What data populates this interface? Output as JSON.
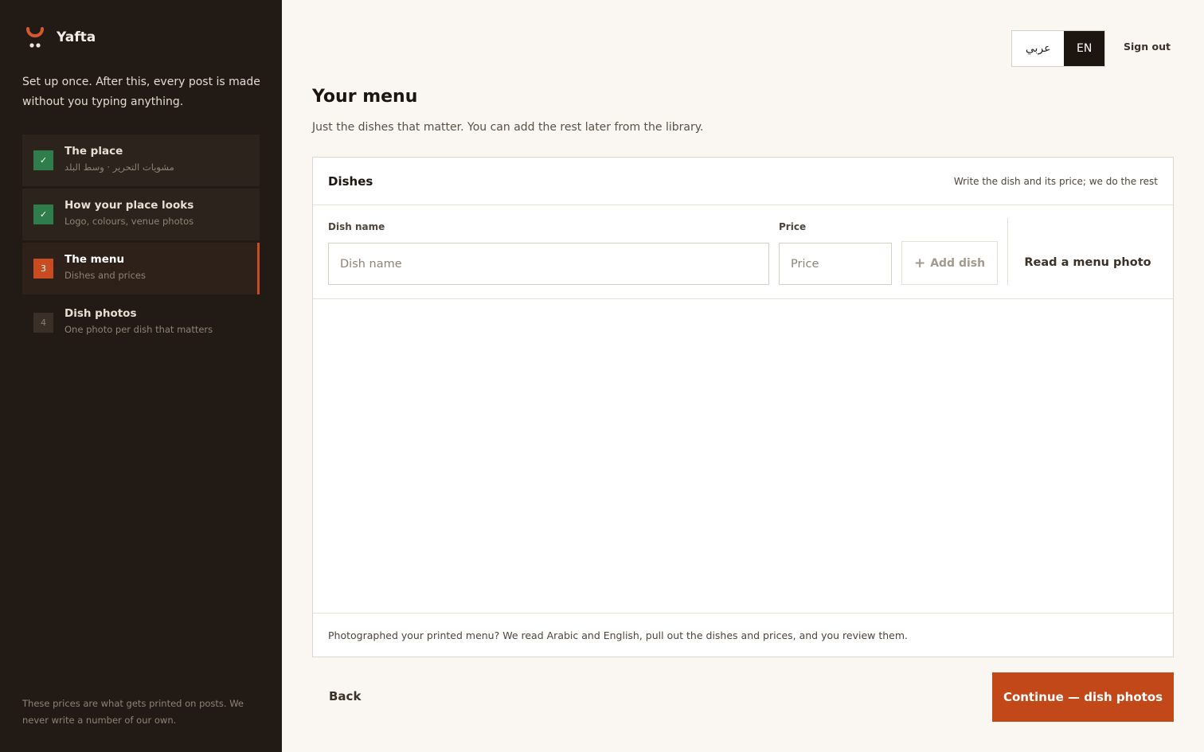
{
  "brand": {
    "name": "Yafta",
    "accent": "#c84b22"
  },
  "sidebar": {
    "tagline": "Set up once. After this, every post is made without you typing anything.",
    "steps": [
      {
        "marker": "✓",
        "title": "The place",
        "subtitle": "مشويات التحرير · وسط البلد",
        "state": "done"
      },
      {
        "marker": "✓",
        "title": "How your place looks",
        "subtitle": "Logo, colours, venue photos",
        "state": "done"
      },
      {
        "marker": "3",
        "title": "The menu",
        "subtitle": "Dishes and prices",
        "state": "current"
      },
      {
        "marker": "4",
        "title": "Dish photos",
        "subtitle": "One photo per dish that matters",
        "state": "upcoming"
      }
    ],
    "note": "These prices are what gets printed on posts. We never write a number of our own."
  },
  "topbar": {
    "lang_ar": "عربي",
    "lang_en": "EN",
    "sign_out": "Sign out"
  },
  "main": {
    "title": "Your menu",
    "subtitle": "Just the dishes that matter. You can add the rest later from the library."
  },
  "card": {
    "title": "Dishes",
    "hint": "Write the dish and its price; we do the rest",
    "dish_label": "Dish name",
    "dish_placeholder": "Dish name",
    "price_label": "Price",
    "price_placeholder": "Price",
    "add_label": "Add dish",
    "read_label": "Read a menu photo",
    "footer": "Photographed your printed menu? We read Arabic and English, pull out the dishes and prices, and you review them."
  },
  "actions": {
    "back": "Back",
    "continue": "Continue — dish photos"
  }
}
